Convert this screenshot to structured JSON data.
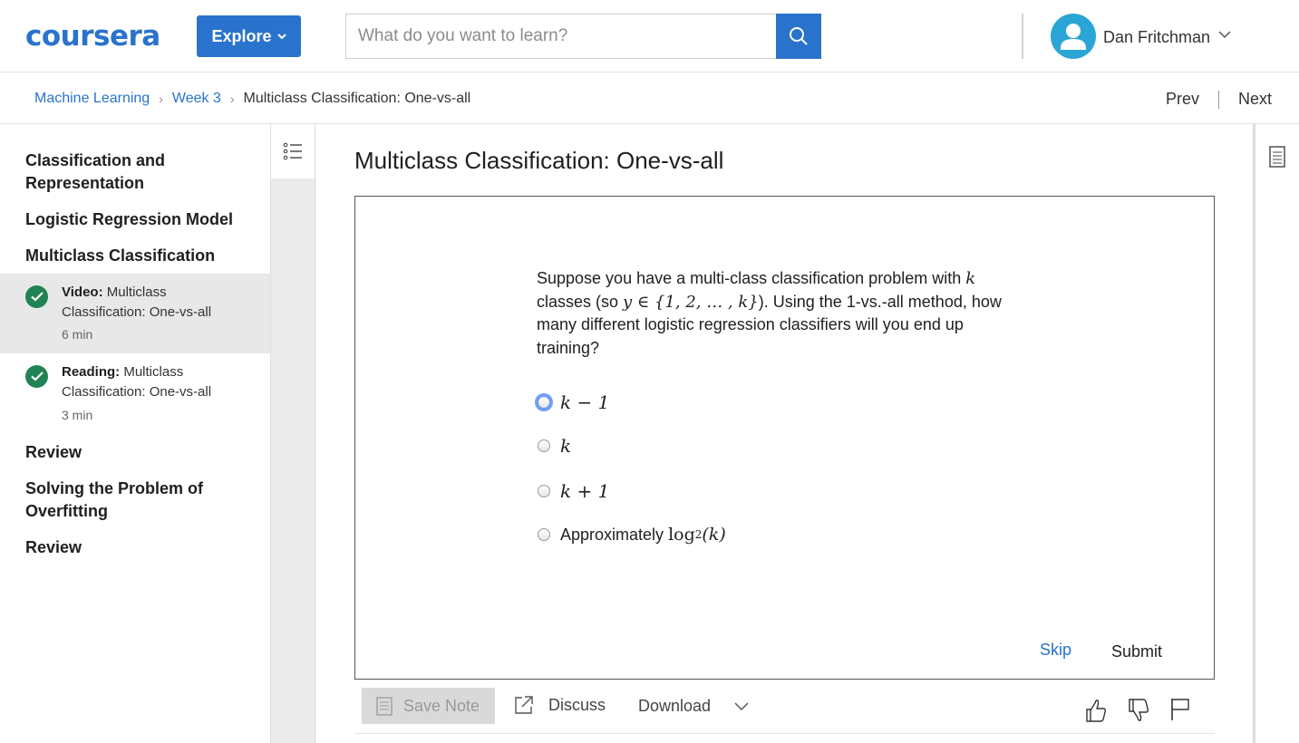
{
  "header": {
    "logo": "coursera",
    "explore_label": "Explore",
    "search_placeholder": "What do you want to learn?",
    "user_name": "Dan Fritchman"
  },
  "breadcrumb": {
    "items": [
      "Machine Learning",
      "Week 3",
      "Multiclass Classification: One-vs-all"
    ],
    "prev": "Prev",
    "next": "Next"
  },
  "sidebar": {
    "sections": [
      "Classification and Representation",
      "Logistic Regression Model",
      "Multiclass Classification",
      "Review",
      "Solving the Problem of Overfitting",
      "Review"
    ],
    "items": [
      {
        "type": "Video:",
        "title": "Multiclass Classification: One-vs-all",
        "duration": "6 min",
        "active": true
      },
      {
        "type": "Reading:",
        "title": "Multiclass Classification: One-vs-all",
        "duration": "3 min",
        "active": false
      }
    ]
  },
  "main": {
    "title": "Multiclass Classification: One-vs-all",
    "question": {
      "part1": "Suppose you have a multi-class classification problem with ",
      "k1": "k",
      "part2": " classes (so ",
      "set": "y ∈ {1, 2, … , k}",
      "part3": "). Using the 1-vs.-all method, how many different logistic regression classifiers will you end up training?"
    },
    "options": [
      "k − 1",
      "k",
      "k + 1",
      "log"
    ],
    "option4_prefix": "Approximately ",
    "option4_sub": "2",
    "option4_arg": "(k)",
    "skip": "Skip",
    "submit": "Submit"
  },
  "toolbar": {
    "save_note": "Save Note",
    "discuss": "Discuss",
    "download": "Download"
  },
  "colors": {
    "brand": "#2a73cc",
    "check": "#1f8354"
  }
}
